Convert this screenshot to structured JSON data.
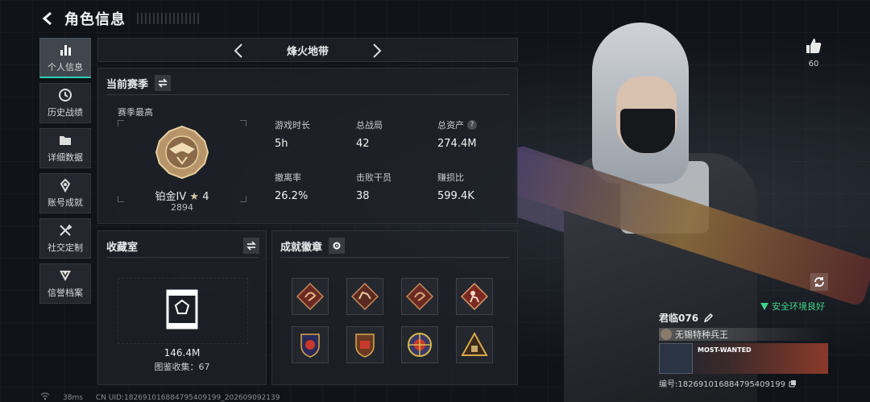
{
  "header": {
    "title": "角色信息"
  },
  "sidebar": {
    "items": [
      {
        "label": "个人信息",
        "icon": "bar-chart-icon",
        "active": true
      },
      {
        "label": "历史战绩",
        "icon": "clock-icon"
      },
      {
        "label": "详细数据",
        "icon": "folder-icon"
      },
      {
        "label": "账号成就",
        "icon": "achievement-icon"
      },
      {
        "label": "社交定制",
        "icon": "tools-icon"
      },
      {
        "label": "信誉档案",
        "icon": "shield-icon"
      }
    ]
  },
  "mode_bar": {
    "name": "烽火地带"
  },
  "season": {
    "title": "当前赛季",
    "best_label": "赛季最高",
    "rank_name": "铂金IV",
    "rank_stars": "4",
    "rank_points": "2894",
    "stats": [
      {
        "label": "游戏时长",
        "value": "5h"
      },
      {
        "label": "总战局",
        "value": "42"
      },
      {
        "label": "总资产",
        "value": "274.4M",
        "help": "?"
      },
      {
        "label": "撤离率",
        "value": "26.2%"
      },
      {
        "label": "击败干员",
        "value": "38"
      },
      {
        "label": "赚损比",
        "value": "599.4K"
      }
    ]
  },
  "collection": {
    "title": "收藏室",
    "value": "146.4M",
    "count_label": "图鉴收集：67"
  },
  "badges": {
    "title": "成就徽章",
    "items": [
      "badge-1",
      "badge-2",
      "badge-3",
      "badge-4",
      "badge-5",
      "badge-6",
      "badge-7",
      "badge-8"
    ]
  },
  "right": {
    "likes": "60",
    "env_status": "安全环境良好",
    "player_name": "君临076",
    "player_title": "无锡特种兵王",
    "banner_text": "MOST-WANTED",
    "player_id": "编号:1826910168847954091​99"
  },
  "footer": {
    "ping": "38ms",
    "uid": "CN UID:1826910168847954091​99_202609092139"
  },
  "colors": {
    "accent": "#2fd3b0",
    "safe": "#3fd28a"
  }
}
